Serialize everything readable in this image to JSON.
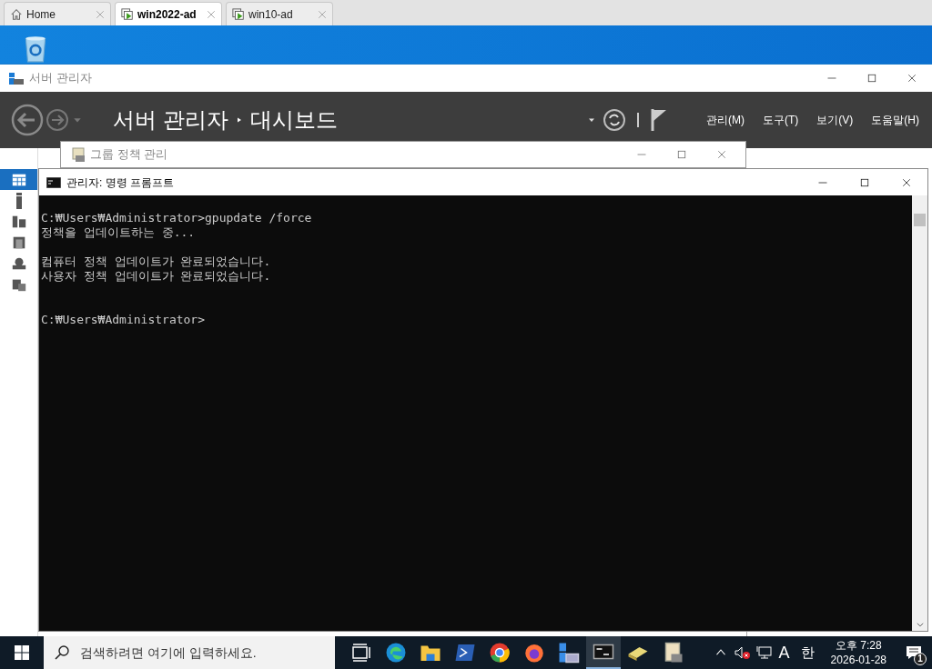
{
  "browser_tabs": [
    {
      "label": "Home",
      "kind": "home",
      "selected": false
    },
    {
      "label": "win2022-ad",
      "kind": "vm",
      "selected": true
    },
    {
      "label": "win10-ad",
      "kind": "vm",
      "selected": false
    }
  ],
  "server_manager": {
    "title": "서버 관리자",
    "breadcrumb": [
      "서버 관리자",
      "대시보드"
    ],
    "menus": [
      "관리(M)",
      "도구(T)",
      "보기(V)",
      "도움말(H)"
    ],
    "nav": [
      {
        "kind": "dashboard",
        "selected": true
      },
      {
        "kind": "local",
        "selected": false
      },
      {
        "kind": "all",
        "selected": false
      },
      {
        "kind": "roles",
        "selected": false
      },
      {
        "kind": "ad",
        "selected": false
      },
      {
        "kind": "files",
        "selected": false
      }
    ]
  },
  "gpm_window": {
    "title": "그룹 정책 관리"
  },
  "cmd_window": {
    "title": "관리자: 명령 프롬프트",
    "lines": [
      {
        "kind": "command",
        "text": "C:₩Users₩Administrator>gpupdate /force"
      },
      {
        "kind": "output",
        "text": "정책을 업데이트하는 중..."
      },
      {
        "kind": "result",
        "text": "컴퓨터 정책 업데이트가 완료되었습니다."
      },
      {
        "kind": "output",
        "text": "사용자 정책 업데이트가 완료되었습니다."
      },
      {
        "kind": "prompt",
        "text": "C:₩Users₩Administrator>"
      }
    ]
  },
  "taskbar": {
    "search": {
      "placeholder": "검색하려면 여기에 입력하세요."
    },
    "apps": [
      {
        "kind": "taskview",
        "selected": false
      },
      {
        "kind": "edge",
        "selected": false
      },
      {
        "kind": "explorer",
        "selected": false
      },
      {
        "kind": "powershell",
        "selected": false
      },
      {
        "kind": "chrome",
        "selected": false
      },
      {
        "kind": "firefox",
        "selected": false
      },
      {
        "kind": "servermanager",
        "selected": false
      },
      {
        "kind": "cmd",
        "selected": true
      },
      {
        "kind": "gpm",
        "selected": false
      },
      {
        "kind": "script",
        "selected": false
      }
    ],
    "tray": {
      "ime_mode": "A",
      "ime_lang": "한",
      "time": "오후 7:28",
      "date": "2026-01-28",
      "notifications": "1"
    }
  }
}
